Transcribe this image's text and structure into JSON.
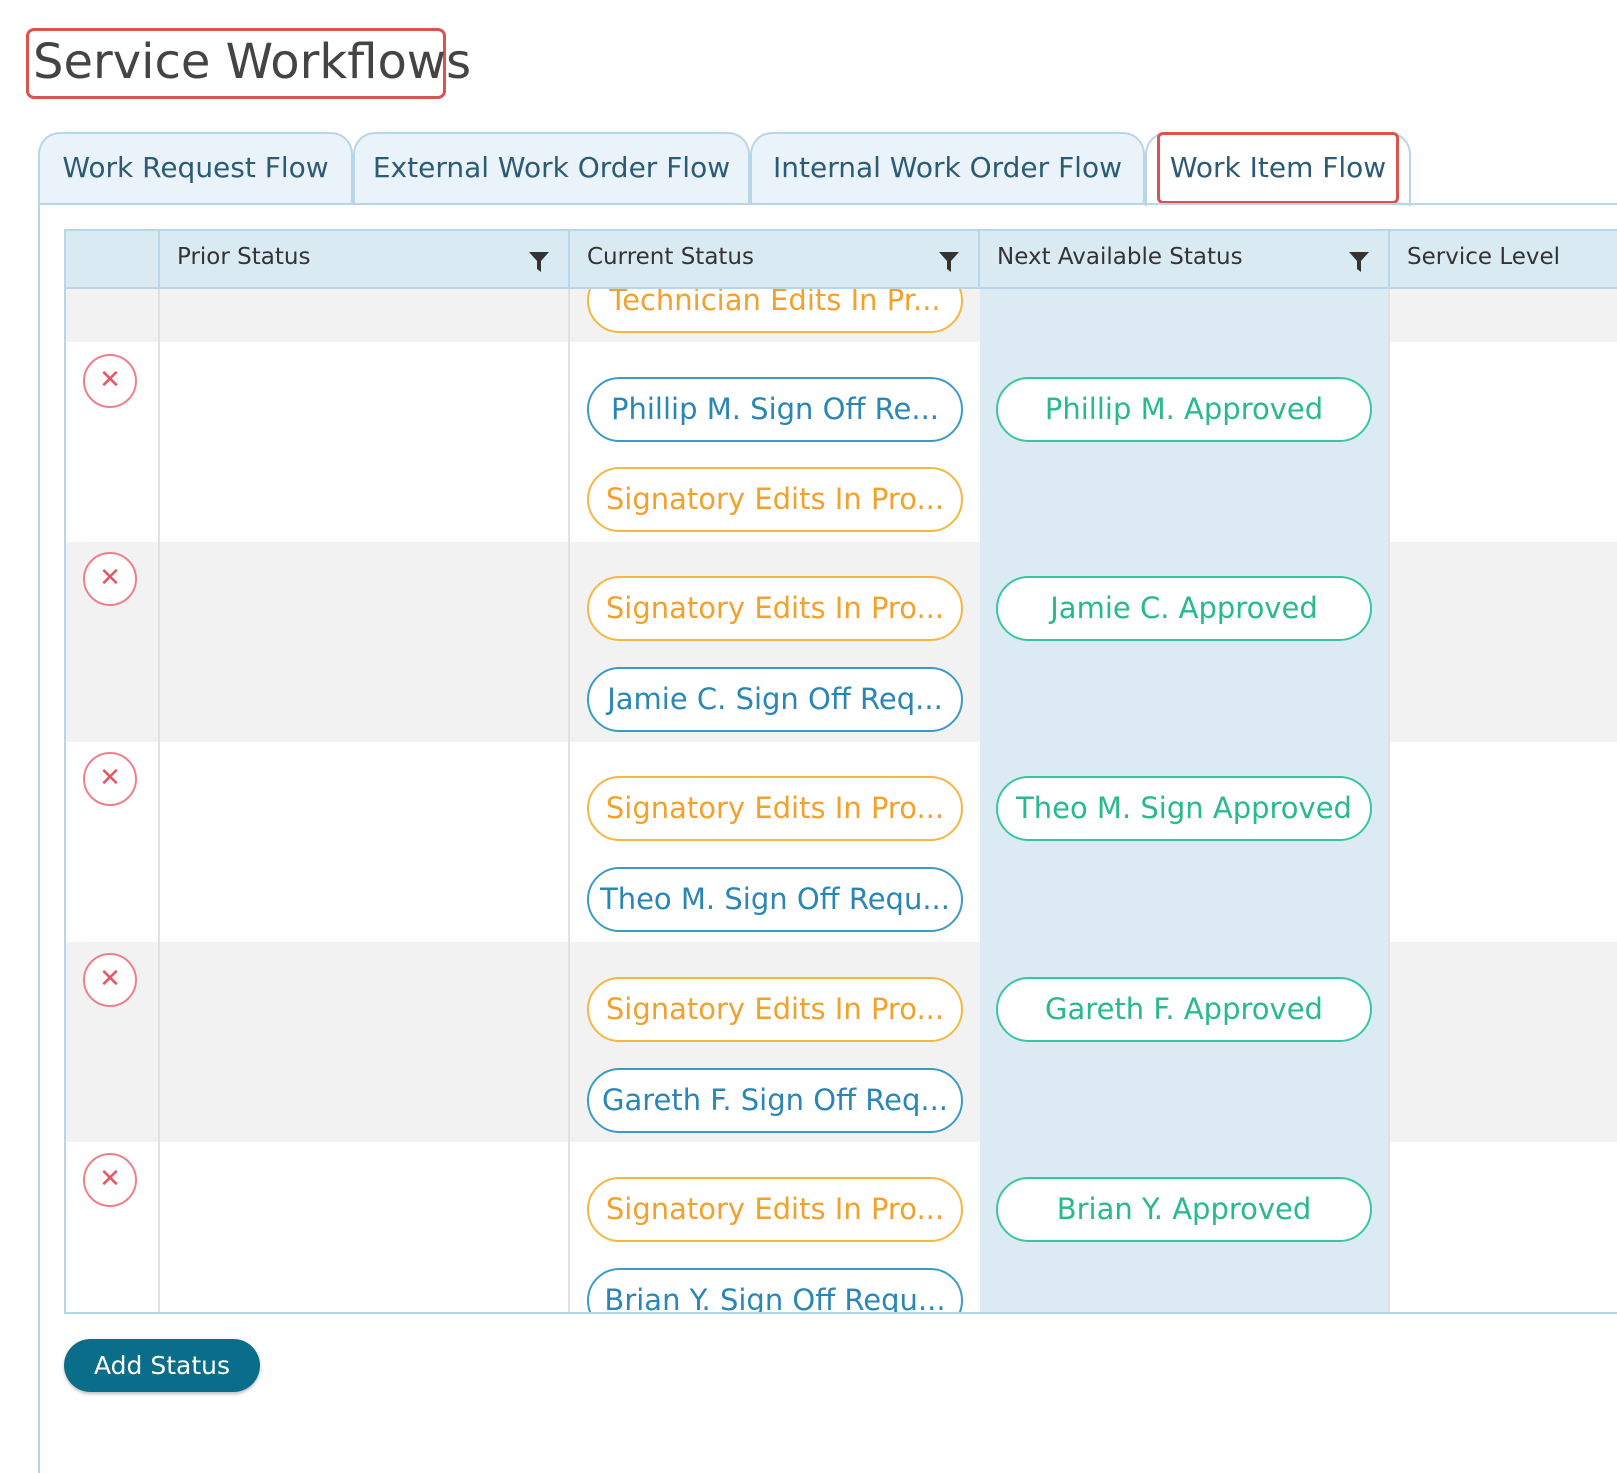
{
  "page": {
    "title": "Service Workflows"
  },
  "tabs": [
    {
      "label": "Work Request Flow",
      "active": false
    },
    {
      "label": "External Work Order Flow",
      "active": false
    },
    {
      "label": "Internal Work Order Flow",
      "active": false
    },
    {
      "label": "Work Item Flow",
      "active": true
    }
  ],
  "grid": {
    "columns": [
      "",
      "Prior Status",
      "Current Status",
      "Next Available Status",
      "Service Level"
    ],
    "rows": [
      {
        "current": [
          "Technician Edits In Pr..."
        ],
        "next": ""
      },
      {
        "current": [
          "Phillip M. Sign Off Re...",
          "Signatory Edits In Pro..."
        ],
        "next": "Phillip M. Approved"
      },
      {
        "current": [
          "Signatory Edits In Pro...",
          "Jamie C. Sign Off Req..."
        ],
        "next": "Jamie C. Approved"
      },
      {
        "current": [
          "Signatory Edits In Pro...",
          "Theo M. Sign Off Requ..."
        ],
        "next": "Theo M. Sign Approved"
      },
      {
        "current": [
          "Signatory Edits In Pro...",
          "Gareth F. Sign Off Req..."
        ],
        "next": "Gareth F. Approved"
      },
      {
        "current": [
          "Signatory Edits In Pro...",
          "Brian Y. Sign Off Requ..."
        ],
        "next": "Brian Y. Approved"
      }
    ]
  },
  "actions": {
    "add_status": "Add Status",
    "remove_glyph": "✕"
  },
  "colors": {
    "orange": "#f2a12d",
    "blue": "#2a86b4",
    "green": "#28b98c",
    "remove": "#e8555f",
    "primary_button": "#0a6e8b"
  }
}
